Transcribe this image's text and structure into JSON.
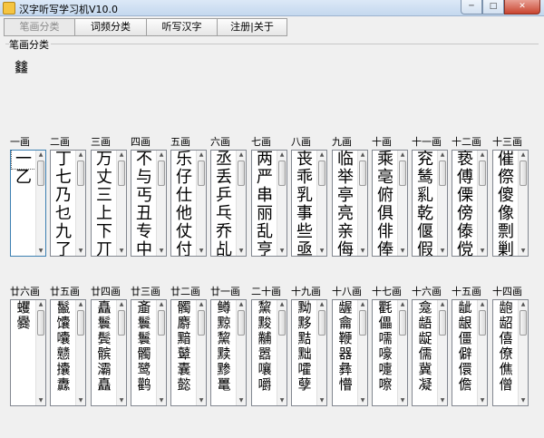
{
  "window": {
    "title": "汉字听写学习机V10.0",
    "min": "─",
    "max": "□",
    "close": "✕"
  },
  "tabs": [
    {
      "label": "笔画分类"
    },
    {
      "label": "词频分类"
    },
    {
      "label": "听写汉字"
    },
    {
      "label": "注册|关于"
    }
  ],
  "group": {
    "label": "笔画分类",
    "prompt_char": "𨰻"
  },
  "row1": [
    {
      "head": "一画",
      "chars": [
        "一",
        "乙"
      ]
    },
    {
      "head": "二画",
      "chars": [
        "丁",
        "七",
        "乃",
        "乜",
        "九",
        "了"
      ]
    },
    {
      "head": "三画",
      "chars": [
        "万",
        "丈",
        "三",
        "上",
        "下",
        "丌"
      ]
    },
    {
      "head": "四画",
      "chars": [
        "不",
        "与",
        "丐",
        "丑",
        "专",
        "中"
      ]
    },
    {
      "head": "五画",
      "chars": [
        "乐",
        "仔",
        "仕",
        "他",
        "仗",
        "付"
      ]
    },
    {
      "head": "六画",
      "chars": [
        "丞",
        "丢",
        "乒",
        "乓",
        "乔",
        "乩"
      ]
    },
    {
      "head": "七画",
      "chars": [
        "两",
        "严",
        "串",
        "丽",
        "乱",
        "亨"
      ]
    },
    {
      "head": "八画",
      "chars": [
        "丧",
        "乖",
        "乳",
        "事",
        "些",
        "亟"
      ]
    },
    {
      "head": "九画",
      "chars": [
        "临",
        "举",
        "亭",
        "亮",
        "亲",
        "侮"
      ]
    },
    {
      "head": "十画",
      "chars": [
        "乘",
        "亳",
        "俯",
        "俱",
        "俳",
        "俸"
      ]
    },
    {
      "head": "十一画",
      "chars": [
        "兖",
        "鸶",
        "乿",
        "乾",
        "偃",
        "假"
      ]
    },
    {
      "head": "十二画",
      "chars": [
        "亵",
        "傅",
        "傈",
        "傍",
        "傣",
        "傥"
      ]
    },
    {
      "head": "十三画",
      "chars": [
        "催",
        "傺",
        "傻",
        "像",
        "剽",
        "剿"
      ]
    }
  ],
  "row2": [
    {
      "head": "廿六画",
      "chars": [
        "蠼",
        "爨"
      ]
    },
    {
      "head": "廿五画",
      "chars": [
        "鬣",
        "馕",
        "囔",
        "戆",
        "攮",
        "纛"
      ]
    },
    {
      "head": "廿四画",
      "chars": [
        "矗",
        "鬟",
        "鬓",
        "髌",
        "灞",
        "矗"
      ]
    },
    {
      "head": "廿三画",
      "chars": [
        "齑",
        "鬟",
        "鬟",
        "髑",
        "鹭",
        "鹳"
      ]
    },
    {
      "head": "廿二画",
      "chars": [
        "髑",
        "麝",
        "黯",
        "鼙",
        "囊",
        "懿"
      ]
    },
    {
      "head": "廿一画",
      "chars": [
        "鳟",
        "黥",
        "黧",
        "黩",
        "黪",
        "鼍"
      ]
    },
    {
      "head": "二十画",
      "chars": [
        "黧",
        "黢",
        "黼",
        "嚣",
        "嚷",
        "嚼"
      ]
    },
    {
      "head": "十九画",
      "chars": [
        "黝",
        "黟",
        "黠",
        "黜",
        "嚯",
        "孽"
      ]
    },
    {
      "head": "十八画",
      "chars": [
        "龌",
        "龠",
        "鞭",
        "器",
        "彝",
        "懵"
      ]
    },
    {
      "head": "十七画",
      "chars": [
        "氍",
        "儡",
        "嚅",
        "嚎",
        "嚏",
        "嚓"
      ]
    },
    {
      "head": "十六画",
      "chars": [
        "龛",
        "龉",
        "龊",
        "儒",
        "冀",
        "凝"
      ]
    },
    {
      "head": "十五画",
      "chars": [
        "龇",
        "龈",
        "僵",
        "僻",
        "儇",
        "儋"
      ]
    },
    {
      "head": "十四画",
      "chars": [
        "龅",
        "龆",
        "僖",
        "僚",
        "僬",
        "僧"
      ]
    }
  ]
}
